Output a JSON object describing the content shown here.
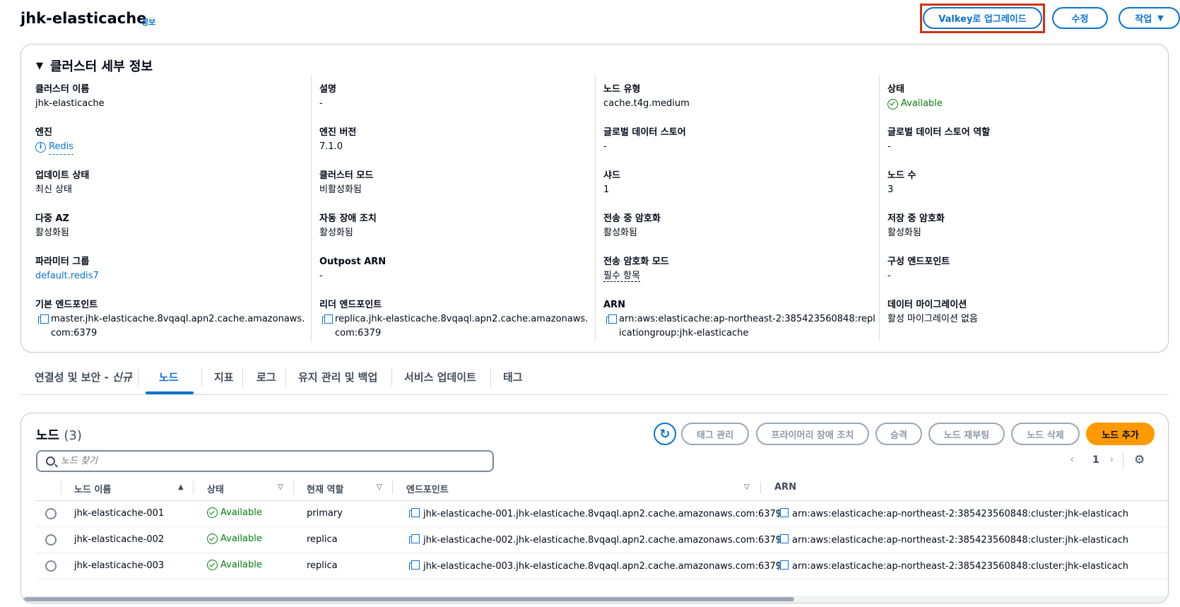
{
  "header": {
    "title": "jhk-elasticache",
    "info_link": "정보",
    "upgrade_button": "Valkey로 업그레이드",
    "modify_button": "수정",
    "actions_button": "작업"
  },
  "details": {
    "heading": "클러스터 세부 정보",
    "fields": {
      "cluster_name": {
        "label": "클러스터 이름",
        "value": "jhk-elasticache"
      },
      "description": {
        "label": "설명",
        "value": "-"
      },
      "node_type": {
        "label": "노드 유형",
        "value": "cache.t4g.medium"
      },
      "status": {
        "label": "상태",
        "value": "Available"
      },
      "engine": {
        "label": "엔진",
        "value": "Redis"
      },
      "engine_version": {
        "label": "엔진 버전",
        "value": "7.1.0"
      },
      "global_datastore": {
        "label": "글로벌 데이터 스토어",
        "value": "-"
      },
      "global_datastore_role": {
        "label": "글로벌 데이터 스토어 역할",
        "value": "-"
      },
      "update_status": {
        "label": "업데이트 상태",
        "value": "최신 상태"
      },
      "cluster_mode": {
        "label": "클러스터 모드",
        "value": "비활성화됨"
      },
      "shards": {
        "label": "샤드",
        "value": "1"
      },
      "node_count": {
        "label": "노드 수",
        "value": "3"
      },
      "multi_az": {
        "label": "다중 AZ",
        "value": "활성화됨"
      },
      "auto_failover": {
        "label": "자동 장애 조치",
        "value": "활성화됨"
      },
      "transit_encryption": {
        "label": "전송 중 암호화",
        "value": "활성화됨"
      },
      "at_rest_encryption": {
        "label": "저장 중 암호화",
        "value": "활성화됨"
      },
      "parameter_group": {
        "label": "파라미터 그룹",
        "value": "default.redis7"
      },
      "outpost_arn": {
        "label": "Outpost ARN",
        "value": "-"
      },
      "transit_encryption_mode": {
        "label": "전송 암호화 모드",
        "value": "필수 항목"
      },
      "config_endpoint": {
        "label": "구성 엔드포인트",
        "value": "-"
      },
      "primary_endpoint": {
        "label": "기본 엔드포인트",
        "value": "master.jhk-elasticache.8vqaql.apn2.cache.amazonaws.com:6379"
      },
      "reader_endpoint": {
        "label": "리더 엔드포인트",
        "value": "replica.jhk-elasticache.8vqaql.apn2.cache.amazonaws.com:6379"
      },
      "arn": {
        "label": "ARN",
        "value": "arn:aws:elasticache:ap-northeast-2:385423560848:replicationgroup:jhk-elasticache"
      },
      "data_migration": {
        "label": "데이터 마이그레이션",
        "value": "활성 마이그레이션 없음"
      }
    }
  },
  "tabs": {
    "t0": "연결성 및 보안 - ",
    "t0_new": "신규",
    "t1": "노드",
    "t2": "지표",
    "t3": "로그",
    "t4": "유지 관리 및 백업",
    "t5": "서비스 업데이트",
    "t6": "태그"
  },
  "nodes": {
    "title": "노드",
    "count": "(3)",
    "buttons": {
      "manage_tags": "태그 관리",
      "failover_primary": "프라이머리 장애 조치",
      "promote": "승격",
      "reboot": "노드 재부팅",
      "delete": "노드 삭제",
      "add": "노드 추가"
    },
    "search_placeholder": "노드 찾기",
    "page": "1",
    "columns": {
      "name": "노드 이름",
      "status": "상태",
      "role": "현재 역할",
      "endpoint": "엔드포인트",
      "arn": "ARN"
    },
    "rows": [
      {
        "name": "jhk-elasticache-001",
        "status": "Available",
        "role": "primary",
        "endpoint": "jhk-elasticache-001.jhk-elasticache.8vqaql.apn2.cache.amazonaws.com:6379",
        "arn": "arn:aws:elasticache:ap-northeast-2:385423560848:cluster:jhk-elasticach"
      },
      {
        "name": "jhk-elasticache-002",
        "status": "Available",
        "role": "replica",
        "endpoint": "jhk-elasticache-002.jhk-elasticache.8vqaql.apn2.cache.amazonaws.com:6379",
        "arn": "arn:aws:elasticache:ap-northeast-2:385423560848:cluster:jhk-elasticach"
      },
      {
        "name": "jhk-elasticache-003",
        "status": "Available",
        "role": "replica",
        "endpoint": "jhk-elasticache-003.jhk-elasticache.8vqaql.apn2.cache.amazonaws.com:6379",
        "arn": "arn:aws:elasticache:ap-northeast-2:385423560848:cluster:jhk-elasticach"
      }
    ]
  }
}
